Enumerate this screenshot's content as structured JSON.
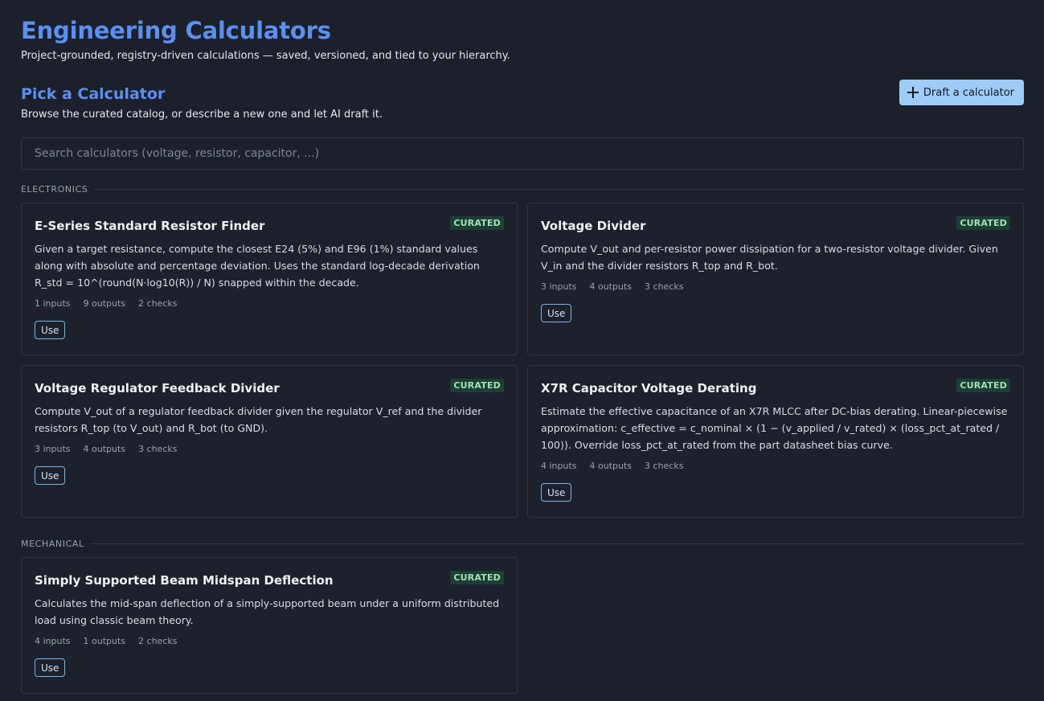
{
  "header": {
    "title": "Engineering Calculators",
    "subtitle": "Project-grounded, registry-driven calculations — saved, versioned, and tied to your hierarchy."
  },
  "picker": {
    "title": "Pick a Calculator",
    "description": "Browse the curated catalog, or describe a new one and let AI draft it.",
    "draft_button_label": "Draft a calculator",
    "search_placeholder": "Search calculators (voltage, resistor, capacitor, ...)",
    "search_value": ""
  },
  "colors": {
    "accent": "#5b8ff0",
    "button": "#9dcdf7",
    "badge_bg": "#1f3e33",
    "badge_text": "#9ce4b5",
    "background": "#1b202b"
  },
  "categories": [
    {
      "label": "ELECTRONICS",
      "calculators": [
        {
          "title": "E-Series Standard Resistor Finder",
          "badge": "CURATED",
          "description": "Given a target resistance, compute the closest E24 (5%) and E96 (1%) standard values along with absolute and percentage deviation. Uses the standard log-decade derivation R_std = 10^(round(N·log10(R)) / N) snapped within the decade.",
          "inputs": "1 inputs",
          "outputs": "9 outputs",
          "checks": "2 checks",
          "use_label": "Use"
        },
        {
          "title": "Voltage Divider",
          "badge": "CURATED",
          "description": "Compute V_out and per-resistor power dissipation for a two-resistor voltage divider. Given V_in and the divider resistors R_top and R_bot.",
          "inputs": "3 inputs",
          "outputs": "4 outputs",
          "checks": "3 checks",
          "use_label": "Use"
        },
        {
          "title": "Voltage Regulator Feedback Divider",
          "badge": "CURATED",
          "description": "Compute V_out of a regulator feedback divider given the regulator V_ref and the divider resistors R_top (to V_out) and R_bot (to GND).",
          "inputs": "3 inputs",
          "outputs": "4 outputs",
          "checks": "3 checks",
          "use_label": "Use"
        },
        {
          "title": "X7R Capacitor Voltage Derating",
          "badge": "CURATED",
          "description": "Estimate the effective capacitance of an X7R MLCC after DC-bias derating. Linear-piecewise approximation: c_effective = c_nominal × (1 − (v_applied / v_rated) × (loss_pct_at_rated / 100)). Override loss_pct_at_rated from the part datasheet bias curve.",
          "inputs": "4 inputs",
          "outputs": "4 outputs",
          "checks": "3 checks",
          "use_label": "Use"
        }
      ]
    },
    {
      "label": "MECHANICAL",
      "calculators": [
        {
          "title": "Simply Supported Beam Midspan Deflection",
          "badge": "CURATED",
          "description": "Calculates the mid-span deflection of a simply-supported beam under a uniform distributed load using classic beam theory.",
          "inputs": "4 inputs",
          "outputs": "1 outputs",
          "checks": "2 checks",
          "use_label": "Use"
        }
      ]
    }
  ]
}
